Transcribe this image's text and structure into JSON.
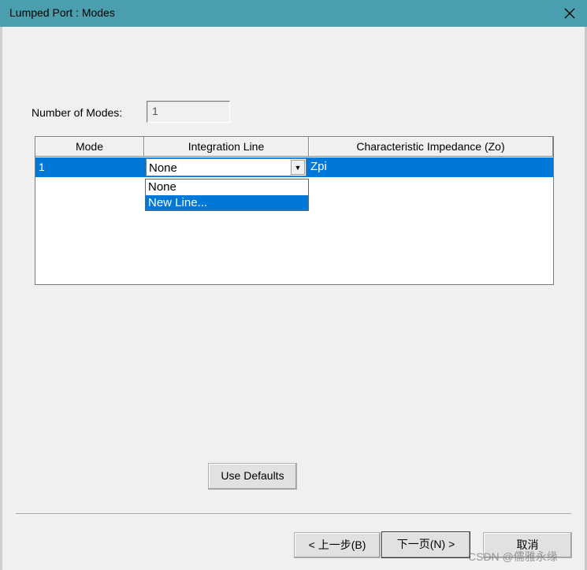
{
  "window": {
    "title": "Lumped Port : Modes",
    "close_icon": "×"
  },
  "modes": {
    "label": "Number of Modes:",
    "value": "1"
  },
  "table": {
    "columns": [
      "Mode",
      "Integration Line",
      "Characteristic Impedance (Zo)"
    ],
    "rows": [
      {
        "mode": "1",
        "integration_line": "None",
        "impedance": "Zpi"
      }
    ]
  },
  "dropdown": {
    "options": [
      "None",
      "New Line..."
    ],
    "highlighted": "New Line...",
    "arrow_icon": "▼"
  },
  "buttons": {
    "use_defaults": "Use Defaults",
    "back": "< 上一步(B)",
    "next": "下一页(N) >",
    "cancel": "取消"
  },
  "watermark": "CSDN @儒雅永缘",
  "colors": {
    "titlebar": "#4a9ead",
    "selection": "#0078d7",
    "background": "#f0f0f0"
  }
}
